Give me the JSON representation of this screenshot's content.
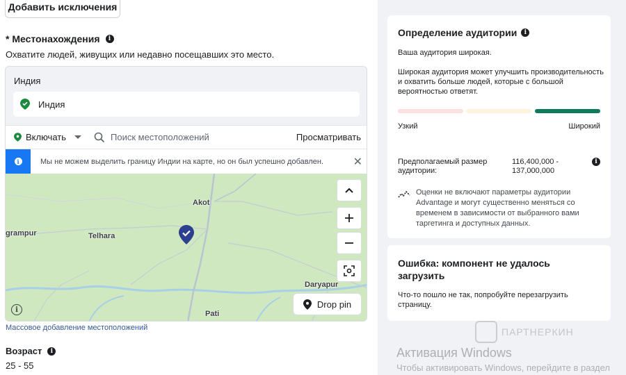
{
  "exclusions_button": "Добавить исключения",
  "location": {
    "title": "* Местонахождения",
    "subtitle": "Охватите людей, живущих или недавно посещавших это место.",
    "country_header": "Индия",
    "selected_location": "Индия",
    "include_label": "Включать",
    "search_placeholder": "Поиск местоположений",
    "browse_label": "Просматривать",
    "notice": "Мы не можем выделить границу Индии на карте, но он был успешно добавлен.",
    "bulk_add_link": "Массовое добавление местоположений",
    "colors": {
      "pin_green": "#1a8a3d",
      "notice_blue": "#1877f2",
      "map_marker": "#2d3f8f"
    }
  },
  "map": {
    "labels": {
      "akot": "Akot",
      "telhara": "Telhara",
      "grampur": "grampur",
      "daryapur": "Daryapur",
      "pati": "Pati"
    },
    "drop_pin_label": "Drop pin"
  },
  "age": {
    "title": "Возраст",
    "value": "25 - 55"
  },
  "audience": {
    "title": "Определение аудитории",
    "status": "Ваша аудитория широкая.",
    "description": "Широкая аудитория может улучшить производительность и охватить больше людей, которые с большой вероятностью ответят.",
    "meter_narrow": "Узкий",
    "meter_wide": "Широкий",
    "meter_colors": [
      "#fbe0e0",
      "#fdf3dd",
      "#0f7b5e"
    ],
    "size_label": "Предполагаемый размер аудитории:",
    "size_value": "116,400,000 - 137,000,000",
    "note": "Оценки не включают параметры аудитории Advantage и могут существенно меняться со временем в зависимости от выбранного вами таргетинга и доступных данных."
  },
  "error_card": {
    "title": "Ошибка: компонент не удалось загрузить",
    "text": "Что-то пошло не так, попробуйте перезагрузить страницу."
  },
  "overlay": {
    "watermark": "ПАРТНЕРКИН",
    "windows_title": "Активация Windows",
    "windows_sub": "Чтобы активировать Windows, перейдите в раздел"
  }
}
